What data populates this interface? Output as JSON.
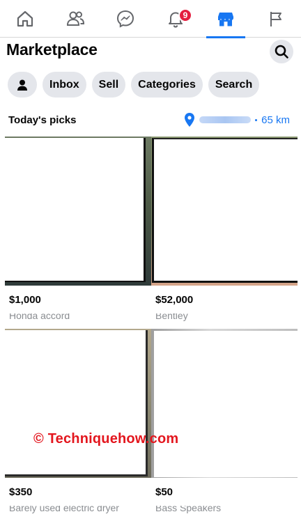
{
  "nav": {
    "items": [
      {
        "icon": "home-icon"
      },
      {
        "icon": "friends-icon"
      },
      {
        "icon": "messenger-icon"
      },
      {
        "icon": "notifications-bell-icon",
        "badge": "9"
      },
      {
        "icon": "marketplace-store-icon",
        "active": true
      },
      {
        "icon": "pages-flag-icon"
      }
    ]
  },
  "header": {
    "title": "Marketplace",
    "search_icon": "search-icon"
  },
  "chips": {
    "profile_icon": "person-icon",
    "inbox": "Inbox",
    "sell": "Sell",
    "categories": "Categories",
    "search": "Search"
  },
  "section": {
    "title": "Today's picks",
    "distance": "65 km",
    "location_icon": "location-pin-icon"
  },
  "listings": [
    {
      "price": "$1,000",
      "title": "Honda accord"
    },
    {
      "price": "$52,000",
      "title": "Bentley"
    },
    {
      "price": "$350",
      "title": "Barely used electric dryer"
    },
    {
      "price": "$50",
      "title": "Bass Speakers"
    }
  ],
  "watermark": "© Techniquehow.com",
  "colors": {
    "accent": "#1877f2",
    "badge": "#e41e3f",
    "chip_bg": "#e4e6eb",
    "watermark": "#e3161e"
  }
}
